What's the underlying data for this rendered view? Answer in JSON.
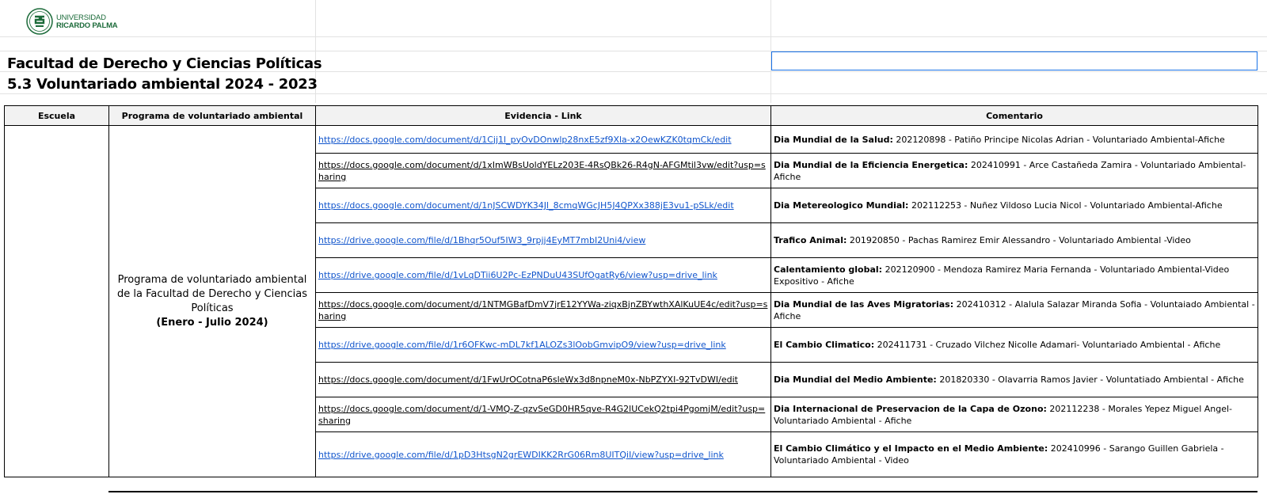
{
  "logo": {
    "line1": "UNIVERSIDAD",
    "line2": "RICARDO PALMA",
    "icon": "university-seal-icon"
  },
  "titles": {
    "faculty": "Facultad de Derecho y Ciencias Políticas",
    "section": "5.3 Voluntariado ambiental 2024 - 2023"
  },
  "table": {
    "headers": {
      "escuela": "Escuela",
      "programa": "Programa de voluntariado ambiental",
      "evidencia": "Evidencia - Link",
      "comentario": "Comentario"
    },
    "program": {
      "line1": "Programa de voluntariado ambiental de la Facultad de Derecho y Ciencias Políticas",
      "period": "(Enero - Julio 2024)"
    },
    "rows": [
      {
        "link": "https://docs.google.com/document/d/1Cjj1l_pyOvDOnwlp28nxE5zf9Xla-x2OewKZK0tqmCk/edit",
        "title": "Dia Mundial de la Salud:",
        "detail": " 202120898 - Patiño Principe Nicolas Adrian - Voluntariado Ambiental-Afiche"
      },
      {
        "link": "https://docs.google.com/document/d/1xImWBsUoldYELz203E-4RsQBk26-R4gN-AFGMtil3vw/edit?usp=sharing",
        "title": "Dia Mundial de la Eficiencia Energetica:",
        "detail": " 202410991 - Arce Castañeda Zamira - Voluntariado Ambiental-Afiche"
      },
      {
        "link": "https://docs.google.com/document/d/1nJSCWDYK34Jl_8cmqWGcJH5J4QPXx388jE3vu1-pSLk/edit",
        "title": "Dia Metereologico Mundial:",
        "detail": " 202112253 - Nuñez Vildoso Lucia Nicol - Voluntariado Ambiental-Afiche"
      },
      {
        "link": "https://drive.google.com/file/d/1Bhqr5Ouf5IW3_9rpjj4EyMT7mbI2Uni4/view",
        "title": "Trafico Animal:",
        "detail": " 201920850 - Pachas Ramirez Emir Alessandro - Voluntariado Ambiental -Video"
      },
      {
        "link": "https://drive.google.com/file/d/1vLqDTii6U2Pc-EzPNDuU43SUfOgatRy6/view?usp=drive_link",
        "title": "Calentamiento global:",
        "detail": " 202120900 - Mendoza Ramirez Maria Fernanda -  Voluntariado Ambiental-Video Expositivo - Afiche"
      },
      {
        "link": "https://docs.google.com/document/d/1NTMGBafDmV7jrE12YYWa-ziqxBjnZBYwthXAlKuUE4c/edit?usp=sharing",
        "title": "Dia Mundial de las Aves Migratorias:",
        "detail": " 202410312 - Alalula Salazar Miranda Sofia - Voluntaiado Ambiental - Afiche"
      },
      {
        "link": "https://drive.google.com/file/d/1r6OFKwc-mDL7kf1ALOZs3lOobGmvipO9/view?usp=drive_link",
        "title": "El Cambio Climatico:",
        "detail": " 202411731 - Cruzado Vilchez Nicolle Adamari- Voluntariado Ambiental - Afiche"
      },
      {
        "link": "https://docs.google.com/document/d/1FwUrOCotnaP6sleWx3d8npneM0x-NbPZYXI-92TvDWI/edit",
        "title": "Dia Mundial del Medio Ambiente:",
        "detail": " 201820330 - Olavarria Ramos Javier - Voluntatiado Ambiental - Afiche"
      },
      {
        "link": "https://docs.google.com/document/d/1-VMQ-Z-qzvSeGD0HR5qve-R4G2lUCekQ2tpi4PgomjM/edit?usp=sharing",
        "title": "Dia Internacional de Preservacion de la Capa de Ozono:",
        "detail": " 202112238 - Morales Yepez Miguel Angel- Voluntariado Ambiental - Afiche"
      },
      {
        "link": "https://drive.google.com/file/d/1pD3HtsgN2grEWDIKK2RrG06Rm8UITQiI/view?usp=drive_link",
        "title": "El Cambio Climático y el Impacto en el Medio Ambiente:",
        "detail": " 202410996 - Sarango Guillen Gabriela - Voluntariado Ambiental - Video"
      }
    ]
  }
}
